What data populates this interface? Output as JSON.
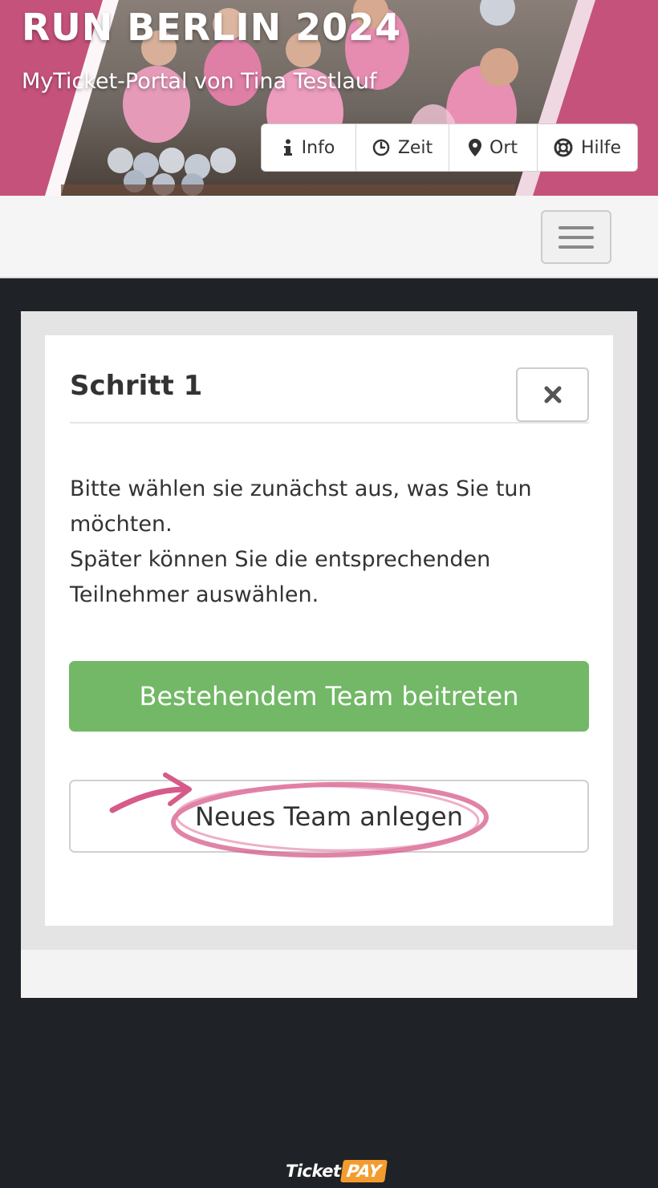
{
  "header": {
    "event_title": "RUN BERLIN 2024",
    "portal_subtitle": "MyTicket-Portal von Tina Testlauf",
    "nav": [
      {
        "label": "Info",
        "icon": "info-icon"
      },
      {
        "label": "Zeit",
        "icon": "clock-icon"
      },
      {
        "label": "Ort",
        "icon": "map-marker-icon"
      },
      {
        "label": "Hilfe",
        "icon": "lifebuoy-icon"
      }
    ]
  },
  "navbar": {
    "menu_icon": "hamburger-menu-icon"
  },
  "modal": {
    "title": "Schritt 1",
    "close_icon": "close-icon",
    "text_line1": "Bitte wählen sie zunächst aus, was Sie tun möchten.",
    "text_line2": "Später können Sie die entsprechenden Teilnehmer auswählen.",
    "join_button": "Bestehendem Team beitreten",
    "new_team_button": "Neues Team anlegen"
  },
  "footer": {
    "logo_ticket": "Ticket",
    "logo_pay": "PAY"
  },
  "colors": {
    "brand_pink": "#c4527b",
    "success_green": "#72b866",
    "annotation_pink": "#d65a8a",
    "page_dark": "#1f2227",
    "ticketpay_orange": "#f39c2e"
  }
}
